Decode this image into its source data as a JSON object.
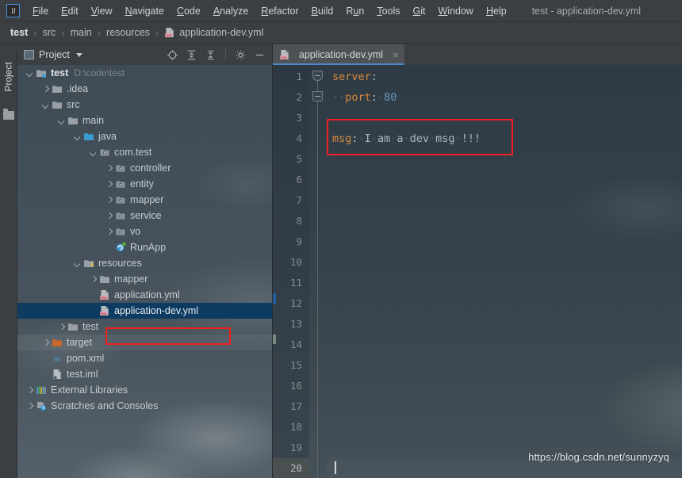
{
  "window": {
    "title": "test - application-dev.yml",
    "logo_text": "IJ"
  },
  "menubar": {
    "items": [
      {
        "label": "File",
        "mnemonic": "F"
      },
      {
        "label": "Edit",
        "mnemonic": "E"
      },
      {
        "label": "View",
        "mnemonic": "V"
      },
      {
        "label": "Navigate",
        "mnemonic": "N"
      },
      {
        "label": "Code",
        "mnemonic": "C"
      },
      {
        "label": "Analyze",
        "mnemonic": "A"
      },
      {
        "label": "Refactor",
        "mnemonic": "R"
      },
      {
        "label": "Build",
        "mnemonic": "B"
      },
      {
        "label": "Run",
        "mnemonic": "u"
      },
      {
        "label": "Tools",
        "mnemonic": "T"
      },
      {
        "label": "Git",
        "mnemonic": "G"
      },
      {
        "label": "Window",
        "mnemonic": "W"
      },
      {
        "label": "Help",
        "mnemonic": "H"
      }
    ]
  },
  "breadcrumb": {
    "separator": "›",
    "items": [
      "test",
      "src",
      "main",
      "resources",
      "application-dev.yml"
    ]
  },
  "toolstrip": {
    "project_tab_label": "Project"
  },
  "project_panel": {
    "title": "Project",
    "tools": [
      {
        "name": "locate-icon",
        "tooltip": "Select Opened File"
      },
      {
        "name": "expand-all-icon",
        "tooltip": "Expand All"
      },
      {
        "name": "collapse-all-icon",
        "tooltip": "Collapse All"
      },
      {
        "name": "gear-icon",
        "tooltip": "Settings"
      },
      {
        "name": "minimize-icon",
        "tooltip": "Hide"
      }
    ],
    "tree": [
      {
        "label": "test",
        "note": "D:\\code\\test",
        "indent": 0,
        "arrow": "down",
        "icon": "module-folder-icon",
        "style": "bold"
      },
      {
        "label": ".idea",
        "note": "",
        "indent": 1,
        "arrow": "right",
        "icon": "folder-icon",
        "style": ""
      },
      {
        "label": "src",
        "note": "",
        "indent": 1,
        "arrow": "down",
        "icon": "folder-icon",
        "style": ""
      },
      {
        "label": "main",
        "note": "",
        "indent": 2,
        "arrow": "down",
        "icon": "folder-icon",
        "style": ""
      },
      {
        "label": "java",
        "note": "",
        "indent": 3,
        "arrow": "down",
        "icon": "source-folder-icon",
        "style": ""
      },
      {
        "label": "com.test",
        "note": "",
        "indent": 4,
        "arrow": "down",
        "icon": "package-icon",
        "style": ""
      },
      {
        "label": "controller",
        "note": "",
        "indent": 5,
        "arrow": "right",
        "icon": "package-icon",
        "style": ""
      },
      {
        "label": "entity",
        "note": "",
        "indent": 5,
        "arrow": "right",
        "icon": "package-icon",
        "style": ""
      },
      {
        "label": "mapper",
        "note": "",
        "indent": 5,
        "arrow": "right",
        "icon": "package-icon",
        "style": ""
      },
      {
        "label": "service",
        "note": "",
        "indent": 5,
        "arrow": "right",
        "icon": "package-icon",
        "style": ""
      },
      {
        "label": "vo",
        "note": "",
        "indent": 5,
        "arrow": "right",
        "icon": "package-icon",
        "style": ""
      },
      {
        "label": "RunApp",
        "note": "",
        "indent": 5,
        "arrow": "none",
        "icon": "spring-class-icon",
        "style": ""
      },
      {
        "label": "resources",
        "note": "",
        "indent": 3,
        "arrow": "down",
        "icon": "resources-folder-icon",
        "style": ""
      },
      {
        "label": "mapper",
        "note": "",
        "indent": 4,
        "arrow": "right",
        "icon": "folder-icon",
        "style": ""
      },
      {
        "label": "application.yml",
        "note": "",
        "indent": 4,
        "arrow": "none",
        "icon": "yml-file-icon",
        "style": ""
      },
      {
        "label": "application-dev.yml",
        "note": "",
        "indent": 4,
        "arrow": "none",
        "icon": "yml-file-icon",
        "style": "selected"
      },
      {
        "label": "test",
        "note": "",
        "indent": 2,
        "arrow": "right",
        "icon": "folder-icon",
        "style": ""
      },
      {
        "label": "target",
        "note": "",
        "indent": 1,
        "arrow": "right",
        "icon": "excluded-folder-icon",
        "style": "hover"
      },
      {
        "label": "pom.xml",
        "note": "",
        "indent": 1,
        "arrow": "none",
        "icon": "maven-icon",
        "style": ""
      },
      {
        "label": "test.iml",
        "note": "",
        "indent": 1,
        "arrow": "none",
        "icon": "iml-file-icon",
        "style": ""
      },
      {
        "label": "External Libraries",
        "note": "",
        "indent": 0,
        "arrow": "right",
        "icon": "libraries-icon",
        "style": ""
      },
      {
        "label": "Scratches and Consoles",
        "note": "",
        "indent": 0,
        "arrow": "right",
        "icon": "scratches-icon",
        "style": ""
      }
    ]
  },
  "editor": {
    "tab": {
      "label": "application-dev.yml",
      "icon": "yml-file-icon",
      "close_label": "×"
    },
    "line_numbers": [
      "1",
      "2",
      "3",
      "4",
      "5",
      "6",
      "7",
      "8",
      "9",
      "10",
      "11",
      "12",
      "13",
      "14",
      "15",
      "16",
      "17",
      "18",
      "19",
      "20"
    ],
    "active_line": "20",
    "lines": [
      {
        "num": "1",
        "key": "server",
        "colon": ":",
        "value": "",
        "indent": 0,
        "type": "key"
      },
      {
        "num": "2",
        "key": "port",
        "colon": ":",
        "value": "80",
        "indent": 1,
        "type": "keyvalue-number"
      },
      {
        "num": "3",
        "key": "",
        "colon": "",
        "value": "",
        "indent": 0,
        "type": "blank"
      },
      {
        "num": "4",
        "key": "msg",
        "colon": ":",
        "value": "I am a dev msg !!!",
        "indent": 0,
        "type": "keyvalue-text"
      }
    ],
    "cursor_line": "20"
  },
  "watermark": {
    "text": "https://blog.csdn.net/sunnyzyq"
  },
  "colors": {
    "chrome_bg": "#3c3f41",
    "editor_bg": "#2e3a44",
    "selection_blue": "#0d3b62",
    "tab_underline": "#4a88c7",
    "yaml_key": "#d98b3a",
    "yaml_number": "#6897bb",
    "yaml_text": "#a9b7c6",
    "annotation_red": "#f02020"
  }
}
